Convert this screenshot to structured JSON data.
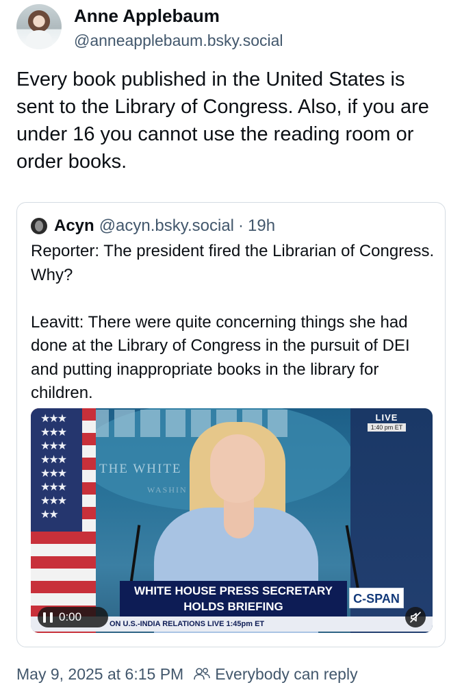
{
  "author": {
    "display_name": "Anne Applebaum",
    "handle": "@anneapplebaum.bsky.social"
  },
  "post": {
    "text": "Every book published in the United States is sent to the Library of Congress. Also, if you are under 16 you cannot use the reading room or order books."
  },
  "quote": {
    "display_name": "Acyn",
    "handle": "@acyn.bsky.social",
    "separator": "·",
    "time": "19h",
    "text": "Reporter: The president fired the Librarian of Congress. Why?\n\nLeavitt: There were quite concerning things she had done at the Library of Congress in the pursuit of DEI and putting inappropriate books in the library for children."
  },
  "video": {
    "backdrop_text": "THE WHITE",
    "backdrop_subtext": "WASHIN",
    "live_label": "LIVE",
    "live_time": "1:40 pm ET",
    "chyron_line1": "WHITE HOUSE PRESS SECRETARY",
    "chyron_line2": "HOLDS BRIEFING",
    "network_logo": "C-SPAN",
    "ticker": "ON U.S.-INDIA RELATIONS  LIVE 1:45pm ET",
    "current_time": "0:00",
    "icons": {
      "play_pause": "pause-icon",
      "mute": "muted-speaker-icon"
    }
  },
  "footer": {
    "date": "May 9, 2025 at 6:15 PM",
    "reply_setting": "Everybody can reply",
    "reply_icon": "people-icon"
  },
  "colors": {
    "text_primary": "#0b0f14",
    "text_secondary": "#42576c",
    "card_border": "#d4dbe2"
  }
}
